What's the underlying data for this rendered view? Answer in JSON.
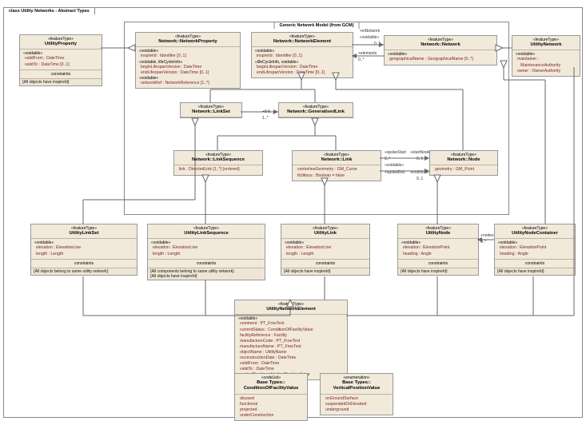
{
  "diagram": {
    "title": "class Utility Networks - Abstract Types",
    "innerFrameTitle": "Generic Network Model (from GCM)"
  },
  "boxes": {
    "utilityProperty": {
      "stereo": "«featureType»",
      "name": "UtilityProperty",
      "voidable": "«voidable»",
      "attrs": [
        "validFrom : DateTime",
        "validTo : DateTime [0..1]"
      ],
      "constraintLabel": "constraints",
      "constraint": "{All objects have inspireId}"
    },
    "networkProperty": {
      "stereo": "«featureType»",
      "name": "Network::NetworkProperty",
      "voidable": "«voidable»",
      "attrs": [
        "inspireId : Identifier [0..1]"
      ],
      "lifeLabel": "«voidable, lifeCycleInfo»",
      "lifeAttrs": [
        "beginLifespanVersion : DateTime",
        "endLifespanVersion : DateTime [0..1]"
      ],
      "voidable2": "«voidable»",
      "attrs2": [
        "networkRef : NetworkReference [1..*]"
      ]
    },
    "networkElement": {
      "stereo": "«featureType»",
      "name": "Network::NetworkElement",
      "voidable": "«voidable»",
      "attrs": [
        "inspireId : Identifier [0..1]"
      ],
      "lifeLabel": "«lifeCycleInfo, voidable»",
      "lifeAttrs": [
        "beginLifespanVersion : DateTime",
        "endLifespanVersion : DateTime [0..1]"
      ]
    },
    "network": {
      "stereo": "«featureType»",
      "name": "Network::Network",
      "voidable": "«voidable»",
      "attrs": [
        "geographicalName : GeographicalName [0..*]"
      ]
    },
    "utilityNetwork": {
      "stereo": "«featureType»",
      "name": "UtilityNetwork",
      "voidable": "«voidable»",
      "attrs": [
        "maintainer : MaintenanceAuthority",
        "owner : OwnerAuthority"
      ]
    },
    "linkSet": {
      "stereo": "«featureType»",
      "name": "Network::LinkSet"
    },
    "generalisedLink": {
      "stereo": "«featureType»",
      "name": "Network::GeneralisedLink"
    },
    "linkSequence": {
      "stereo": "«featureType»",
      "name": "Network::LinkSequence",
      "attrs": [
        "link : DirectedLink [1..*] {ordered}"
      ]
    },
    "link": {
      "stereo": "«featureType»",
      "name": "Network::Link",
      "attrs": [
        "centrelineGeometry : GM_Curve",
        "fictitious : Boolean = false"
      ]
    },
    "node": {
      "stereo": "«featureType»",
      "name": "Network::Node",
      "attrs": [
        "geometry : GM_Point"
      ]
    },
    "utilityLinkSet": {
      "stereo": "«featureType»",
      "name": "UtilityLinkSet",
      "voidable": "«voidable»",
      "attrs": [
        "elevation : ElevationLine",
        "length : Length"
      ],
      "constraintLabel": "constraints",
      "constraint": "{All objects belong to same utility network}"
    },
    "utilityLinkSequence": {
      "stereo": "«featureType»",
      "name": "UtilityLinkSequence",
      "voidable": "«voidable»",
      "attrs": [
        "elevation : ElevationLine",
        "length : Length"
      ],
      "constraintLabel": "constraints",
      "constraint1": "{All components belong to same utility network}",
      "constraint2": "{All objects have inspireId}"
    },
    "utilityLink": {
      "stereo": "«featureType»",
      "name": "UtilityLink",
      "voidable": "«voidable»",
      "attrs": [
        "elevation : ElevationLine",
        "length : Length"
      ],
      "constraintLabel": "constraints",
      "constraint": "{All objects have inspireId}"
    },
    "utilityNode": {
      "stereo": "«featureType»",
      "name": "UtilityNode",
      "voidable": "«voidable»",
      "attrs": [
        "elevation : ElevationPoint",
        "heading : Angle"
      ],
      "constraintLabel": "constraints",
      "constraint": "{All objects have inspireId}"
    },
    "utilityNodeContainer": {
      "stereo": "«featureType»",
      "name": "UtilityNodeContainer",
      "voidable": "«voidable»",
      "attrs": [
        "elevation : ElevationPoint",
        "heading : Angle"
      ],
      "constraintLabel": "constraints",
      "constraint": "{All objects have inspireId}"
    },
    "utilityNetworkElement": {
      "stereo": "«featureType»",
      "name": "UtilityNetworkElement",
      "voidable": "«voidable»",
      "attrs": [
        "comment : PT_FreeText",
        "currentStatus : ConditionOfFacilityValue",
        "facilityReference : Facility",
        "manufactureCode : PT_FreeText",
        "manufactureName : PT_FreeText",
        "objectName : UtilityName",
        "reconstructionDate : DateTime",
        "validFrom : DateTime",
        "validTo : DateTime",
        "verticalPosition : VerticalPositionValue"
      ]
    },
    "conditionEnum": {
      "stereo": "«codeList»",
      "name": "Base Types::",
      "name2": "ConditionOfFacilityValue",
      "vals": [
        "disused",
        "functional",
        "projected",
        "underConstruction"
      ]
    },
    "verticalEnum": {
      "stereo": "«enumeration»",
      "name": "Base Types::",
      "name2": "VerticalPositionValue",
      "vals": [
        "onGroundSurface",
        "suspendedOrElevated",
        "underground"
      ]
    }
  },
  "assoc": {
    "inNetwork": "+inNetwork",
    "voidable": "«voidable»",
    "elements": "+elements",
    "link": "+link",
    "spokeStart": "+spokeStart",
    "spokeEnd": "+spokeEnd",
    "startNode": "+startNode",
    "endNode": "+endNode",
    "nodes": "+nodes",
    "m0n": "0..*",
    "m01": "0..1",
    "m1n": "1..*"
  }
}
